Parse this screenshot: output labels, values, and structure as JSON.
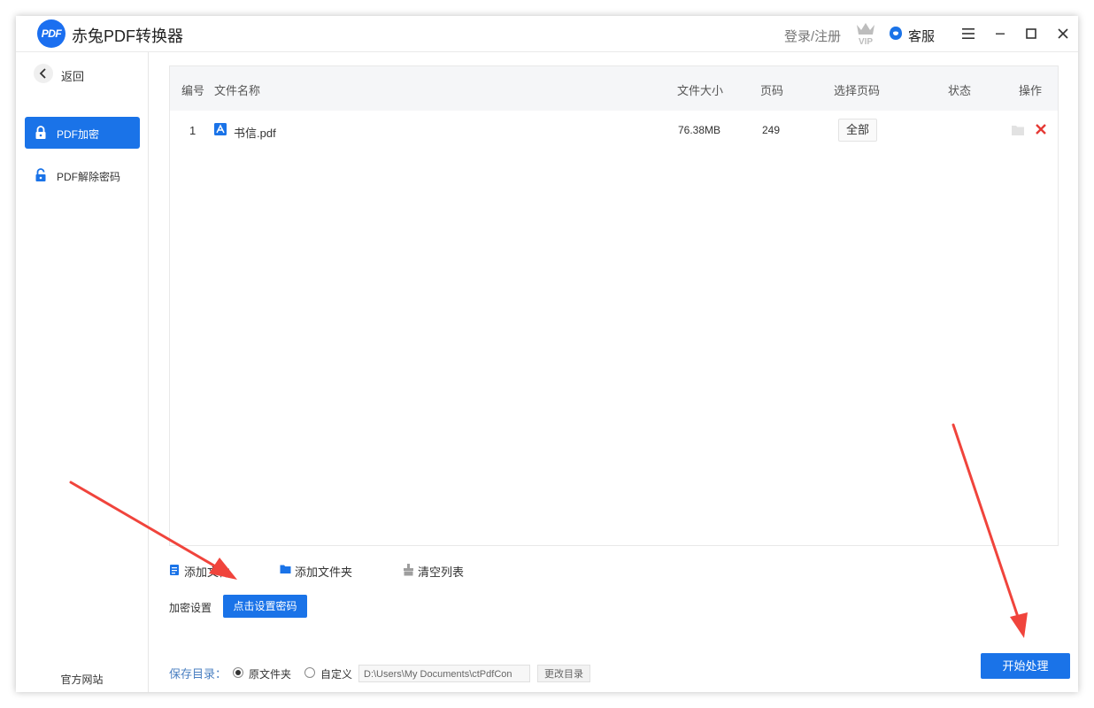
{
  "app": {
    "logo_text": "PDF",
    "title": "赤兔PDF转换器"
  },
  "header": {
    "login_label": "登录/注册",
    "vip_text": "VIP",
    "vip_icon": "crown-vip-icon",
    "customer_service_label": "客服"
  },
  "sidebar": {
    "back_label": "返回",
    "items": [
      {
        "label": "PDF加密",
        "icon": "lock-icon",
        "active": true
      },
      {
        "label": "PDF解除密码",
        "icon": "unlock-icon",
        "active": false
      }
    ],
    "official_site_label": "官方网站"
  },
  "table": {
    "headers": {
      "index": "编号",
      "name": "文件名称",
      "size": "文件大小",
      "pages": "页码",
      "select_pages": "选择页码",
      "status": "状态",
      "actions": "操作"
    },
    "rows": [
      {
        "index": "1",
        "name": "书信.pdf",
        "size": "76.38MB",
        "pages": "249",
        "select_pages": "全部",
        "status": ""
      }
    ]
  },
  "toolbar": {
    "add_file": "添加文件",
    "add_folder": "添加文件夹",
    "clear_list": "清空列表"
  },
  "encryption": {
    "label": "加密设置",
    "set_password_button": "点击设置密码"
  },
  "save": {
    "label": "保存目录：",
    "option_original": "原文件夹",
    "option_custom": "自定义",
    "selected": "原文件夹",
    "path": "D:\\Users\\My Documents\\ctPdfCon",
    "change_dir_button": "更改目录"
  },
  "start_button": "开始处理",
  "colors": {
    "accent": "#1a73e8",
    "delete": "#e53935",
    "annotation_arrow": "#f0443c"
  }
}
